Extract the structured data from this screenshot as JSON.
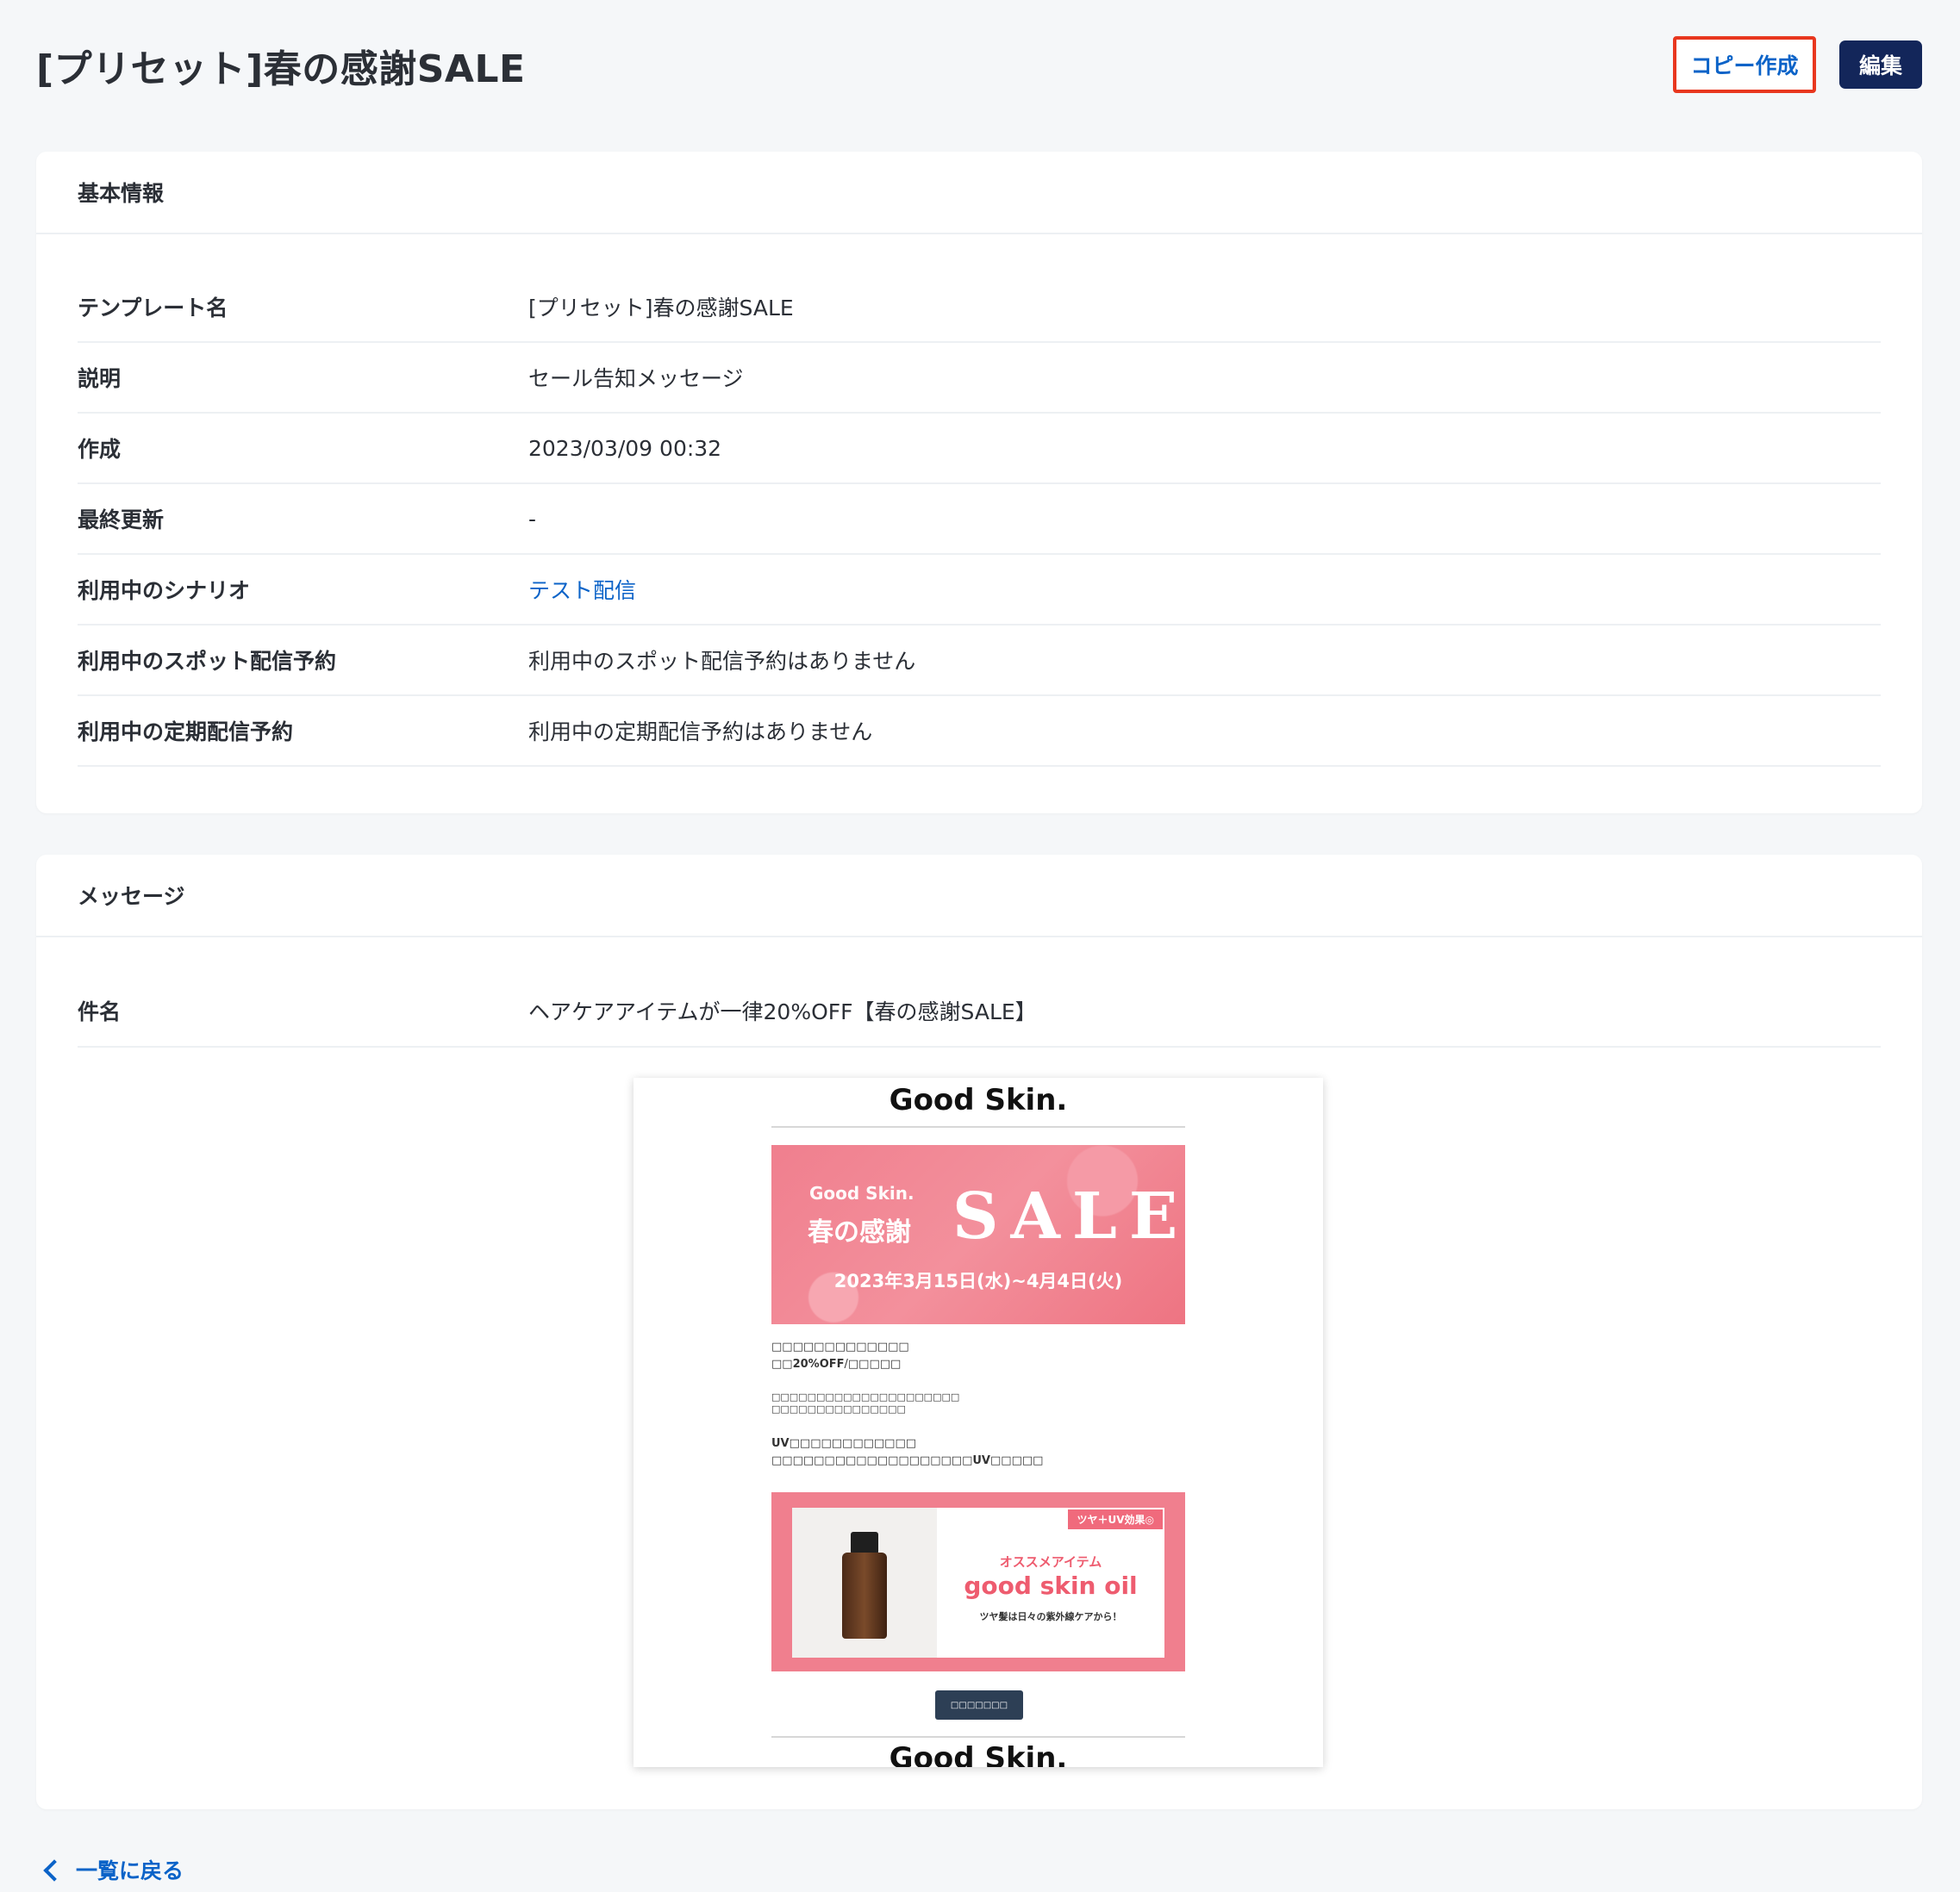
{
  "page": {
    "title": "[プリセット]春の感謝SALE"
  },
  "actions": {
    "copy_label": "コピー作成",
    "edit_label": "編集"
  },
  "basic_info": {
    "heading": "基本情報",
    "rows": [
      {
        "label": "テンプレート名",
        "value": "[プリセット]春の感謝SALE"
      },
      {
        "label": "説明",
        "value": "セール告知メッセージ"
      },
      {
        "label": "作成",
        "value": "2023/03/09 00:32"
      },
      {
        "label": "最終更新",
        "value": "-"
      },
      {
        "label": "利用中のシナリオ",
        "value": "テスト配信"
      },
      {
        "label": "利用中のスポット配信予約",
        "value": "利用中のスポット配信予約はありません"
      },
      {
        "label": "利用中の定期配信予約",
        "value": "利用中の定期配信予約はありません"
      }
    ]
  },
  "message": {
    "heading": "メッセージ",
    "subject_label": "件名",
    "subject_value": "ヘアケアアイテムが一律20%OFF【春の感謝SALE】",
    "preview": {
      "logo": "Good Skin.",
      "banner_brand": "Good Skin.",
      "banner_spring": "春の感謝",
      "banner_sale": "SALE",
      "banner_date": "2023年3月15日(水)~4月4日(火)",
      "text1": "□□□□□□□□□□□□□",
      "text2_prefix": "□□",
      "text2_bold": "20%OFF",
      "text2_suffix": "/□□□□□",
      "text3": "□□□□□□□□□□□□□□□□□□□□□",
      "text4": "□□□□□□□□□□□□□□□",
      "text5_bold": "UV",
      "text5": "□□□□□□□□□□□□",
      "text6": "□□□□□□□□□□□□□□□□□□□",
      "text6_bold": "UV",
      "text6_suffix": "□□□□□",
      "product_tag": "ツヤ＋UV効果◎",
      "product_recommend": "オススメアイテム",
      "product_name": "good skin oil",
      "product_desc": "ツヤ髪は日々の紫外線ケアから！",
      "cta": "□□□□□□□",
      "logo_footer": "Good Skin."
    }
  },
  "footer": {
    "back_label": "一覧に戻る"
  },
  "colors": {
    "accent": "#0b63c8",
    "primary_button": "#13265a",
    "highlight_border": "#e8371f"
  }
}
